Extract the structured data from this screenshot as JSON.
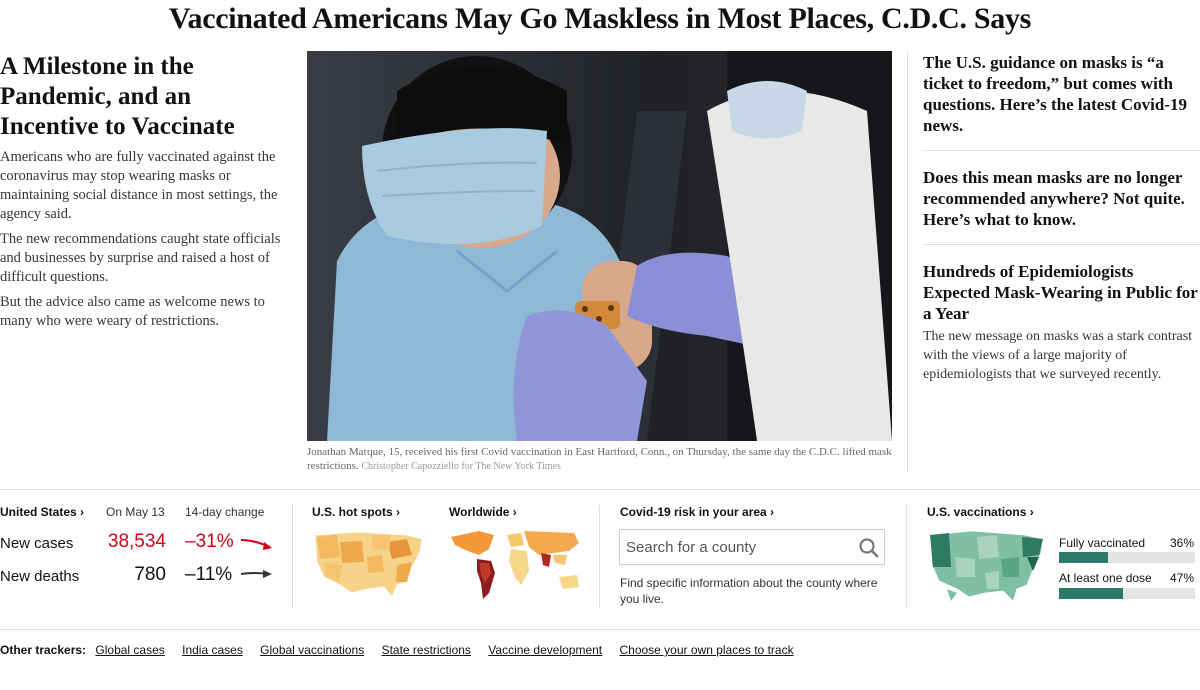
{
  "headline": "Vaccinated Americans May Go Maskless in Most Places, C.D.C. Says",
  "lede": {
    "title": "A Milestone in the Pandemic, and an Incentive to Vaccinate",
    "paragraphs": [
      "Americans who are fully vaccinated against the coronavirus may stop wearing masks or maintaining social distance in most settings, the agency said.",
      "The new recommendations caught state officials and businesses by surprise and raised a host of difficult questions.",
      "But the advice also came as welcome news to many who were weary of restrictions."
    ]
  },
  "photo": {
    "caption": "Jonathan Marque, 15, received his first Covid vaccination in East Hartford, Conn., on Thursday, the same day the C.D.C. lifted mask restrictions.",
    "credit": "Christopher Capozziello for The New York Times"
  },
  "side_stories": [
    {
      "title": "The U.S. guidance on masks is “a ticket to freedom,” but comes with questions. Here’s the latest Covid-19 news.",
      "summary": ""
    },
    {
      "title": "Does this mean masks are no longer recommended anywhere? Not quite. Here’s what to know.",
      "summary": ""
    },
    {
      "title": "Hundreds of Epidemiologists Expected Mask-Wearing in Public for a Year",
      "summary": "The new message on masks was a stark contrast with the views of a large majority of epidemiologists that we surveyed recently."
    }
  ],
  "tracker": {
    "us": {
      "label": "United States ›",
      "date_header": "On May 13",
      "change_header": "14-day change",
      "rows": [
        {
          "label": "New cases",
          "value": "38,534",
          "change": "–31%"
        },
        {
          "label": "New deaths",
          "value": "780",
          "change": "–11%"
        }
      ]
    },
    "hotspots_label": "U.S. hot spots ›",
    "worldwide_label": "Worldwide ›",
    "risk": {
      "label": "Covid-19 risk in your area ›",
      "placeholder": "Search for a county",
      "help": "Find specific information about the county where you live."
    },
    "vaccinations": {
      "label": "U.S. vaccinations ›",
      "rows": [
        {
          "label": "Fully vaccinated",
          "pct": "36%",
          "value": 0.36
        },
        {
          "label": "At least one dose",
          "pct": "47%",
          "value": 0.47
        }
      ]
    }
  },
  "other_trackers": {
    "label": "Other trackers:",
    "links": [
      "Global cases",
      "India cases",
      "Global vaccinations",
      "State restrictions",
      "Vaccine development",
      "Choose your own places to track"
    ]
  },
  "colors": {
    "red": "#d0021b",
    "vax_green": "#2b7a68",
    "rule": "#dfdfdf"
  }
}
